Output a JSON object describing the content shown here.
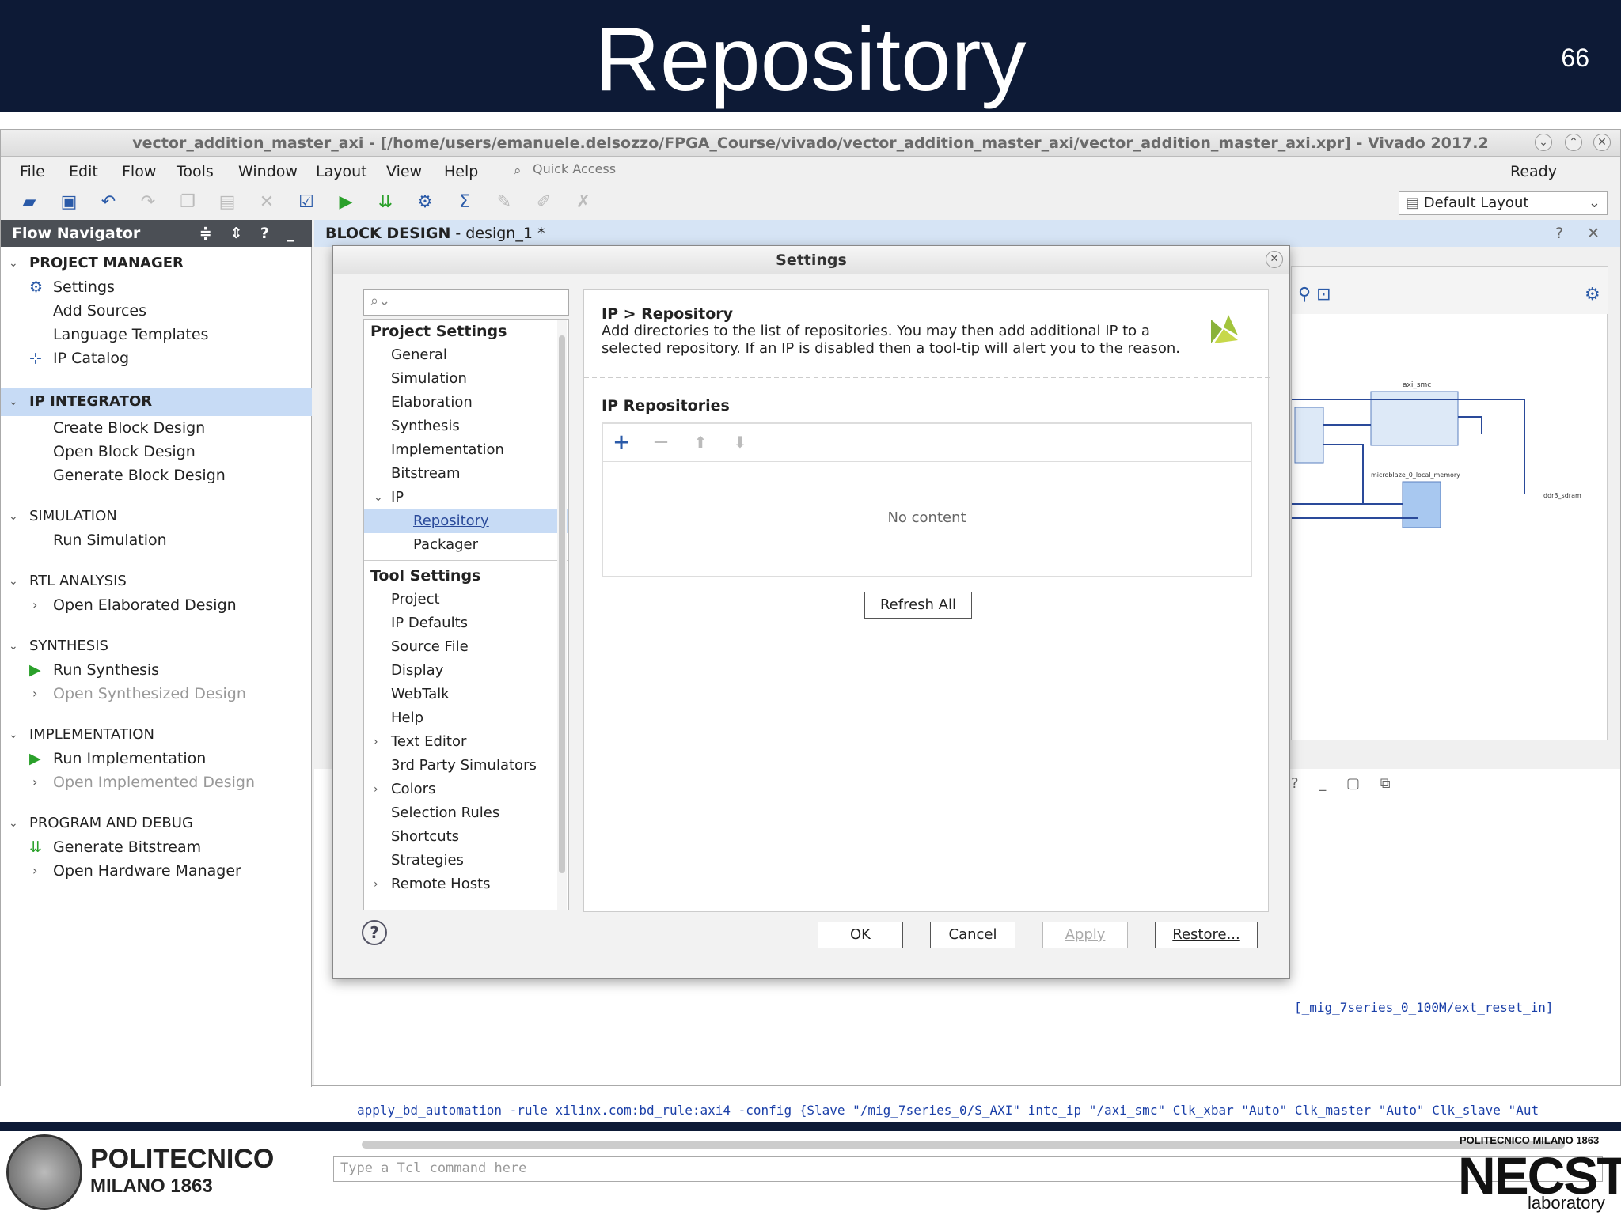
{
  "slide": {
    "title": "Repository",
    "number": "66"
  },
  "app": {
    "title": "vector_addition_master_axi - [/home/users/emanuele.delsozzo/FPGA_Course/vivado/vector_addition_master_axi/vector_addition_master_axi.xpr] - Vivado 2017.2",
    "menu": [
      "File",
      "Edit",
      "Flow",
      "Tools",
      "Window",
      "Layout",
      "View",
      "Help"
    ],
    "quick_access": "Quick Access",
    "status": "Ready",
    "layout": "Default Layout"
  },
  "flow": {
    "title": "Flow Navigator",
    "pm": "PROJECT MANAGER",
    "pm_items": [
      "Settings",
      "Add Sources",
      "Language Templates",
      "IP Catalog"
    ],
    "ipi": "IP INTEGRATOR",
    "ipi_items": [
      "Create Block Design",
      "Open Block Design",
      "Generate Block Design"
    ],
    "sim": "SIMULATION",
    "sim_items": [
      "Run Simulation"
    ],
    "rtl": "RTL ANALYSIS",
    "rtl_items": [
      "Open Elaborated Design"
    ],
    "syn": "SYNTHESIS",
    "syn_items": [
      "Run Synthesis",
      "Open Synthesized Design"
    ],
    "impl": "IMPLEMENTATION",
    "impl_items": [
      "Run Implementation",
      "Open Implemented Design"
    ],
    "pd": "PROGRAM AND DEBUG",
    "pd_items": [
      "Generate Bitstream",
      "Open Hardware Manager"
    ]
  },
  "bd": {
    "title": "BLOCK DESIGN",
    "name": "- design_1 *"
  },
  "console": {
    "line1": "[_mig_7series_0_100M/ext_reset_in]",
    "line2": "apply_bd_automation -rule xilinx.com:bd_rule:axi4 -config {Slave \"/mig_7series_0/S_AXI\" intc_ip \"/axi_smc\" Clk_xbar \"Auto\" Clk_master \"Auto\" Clk_slave \"Aut",
    "tcl_placeholder": "Type a Tcl command here"
  },
  "diagram": {
    "label1": "axi_smc",
    "label2": "microblaze_0_local_memory",
    "label3": "ddr3_sdram"
  },
  "dialog": {
    "title": "Settings",
    "project_settings": "Project Settings",
    "proj_items": [
      "General",
      "Simulation",
      "Elaboration",
      "Synthesis",
      "Implementation",
      "Bitstream"
    ],
    "ip": "IP",
    "ip_children": [
      "Repository",
      "Packager"
    ],
    "tool_settings": "Tool Settings",
    "tool_items": [
      "Project",
      "IP Defaults",
      "Source File",
      "Display",
      "WebTalk",
      "Help",
      "Text Editor",
      "3rd Party Simulators",
      "Colors",
      "Selection Rules",
      "Shortcuts",
      "Strategies",
      "Remote Hosts"
    ],
    "panel_title": "IP > Repository",
    "panel_desc": "Add directories to the list of repositories. You may then add additional IP to a selected repository. If an IP is disabled then a tool-tip will alert you to the reason.",
    "repos_label": "IP Repositories",
    "no_content": "No content",
    "refresh": "Refresh All",
    "ok": "OK",
    "cancel": "Cancel",
    "apply": "Apply",
    "restore": "Restore..."
  },
  "footer": {
    "left": "POLITECNICO",
    "left2": "MILANO 1863",
    "right_top": "POLITECNICO MILANO 1863",
    "right_brand": "NECST",
    "right_sub": "laboratory"
  }
}
